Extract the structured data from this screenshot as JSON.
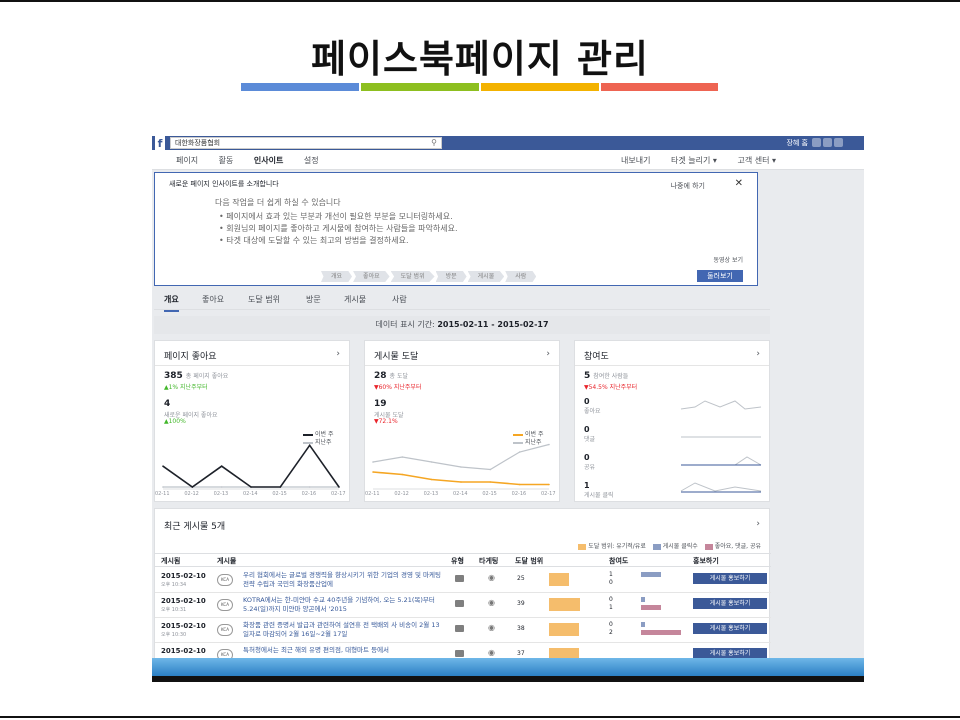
{
  "slide": {
    "title": "페이스북페이지 관리",
    "bar_colors": [
      "#5b8bd8",
      "#8dbf1f",
      "#f3b200",
      "#ee6452"
    ]
  },
  "fb": {
    "search_value": "대한화장품협회",
    "top_right": "장혜  홈",
    "nav_left": [
      "페이지",
      "활동",
      "인사이트",
      "설정"
    ],
    "nav_right": [
      "내보내기",
      "타겟 늘리기 ▾",
      "고객 센터 ▾"
    ],
    "intro": {
      "header": "새로운 페이지 인사이트를 소개합니다",
      "later": "나중에 하기",
      "close": "✕",
      "lead": "다음 작업을 더 쉽게 하실 수 있습니다",
      "bullets": [
        "• 페이지에서 효과 있는 부분과 개선이 필요한 부분을 모니터링하세요.",
        "• 회원님의 페이지를 좋아하고 게시물에 참여하는 사람들을 파악하세요.",
        "• 타겟 대상에 도달할 수 있는 최고의 방법을 결정하세요."
      ],
      "video": "동영상 보기",
      "steps": [
        "개요",
        "좋아요",
        "도달 범위",
        "방문",
        "게시물",
        "사람"
      ],
      "next": "둘러보기"
    },
    "tabs": [
      "개요",
      "좋아요",
      "도달 범위",
      "방문",
      "게시물",
      "사람"
    ],
    "date_label": "데이터 표시 기간:",
    "date_range": "2015-02-11 - 2015-02-17",
    "cards": {
      "likes": {
        "title": "페이지 좋아요",
        "total": "385",
        "total_label": "총 페이지 좋아요",
        "total_change": "▲1% 지난주부터",
        "new": "4",
        "new_label": "새로운 페이지 좋아요",
        "new_change": "▲100%",
        "legend_this": "이번 주",
        "legend_last": "지난주"
      },
      "reach": {
        "title": "게시물 도달",
        "total": "28",
        "total_label": "총 도달",
        "total_change": "▼60% 지난주부터",
        "post": "19",
        "post_label": "게시물 도달",
        "post_change": "▼72.1%",
        "legend_this": "이번 주",
        "legend_last": "지난주"
      },
      "engagement": {
        "title": "참여도",
        "people": "5",
        "people_label": "참여한 사람들",
        "people_change": "▼54.5% 지난주부터",
        "rows": [
          {
            "value": "0",
            "label": "좋아요"
          },
          {
            "value": "0",
            "label": "댓글"
          },
          {
            "value": "0",
            "label": "공유"
          },
          {
            "value": "1",
            "label": "게시물 클릭"
          }
        ]
      }
    },
    "xticks": [
      "02-11",
      "02-12",
      "02-13",
      "02-14",
      "02-15",
      "02-16",
      "02-17"
    ],
    "recent": {
      "title": "최근 게시물 5개",
      "legend": [
        "도달 범위: 유기적/유료",
        "게시물 클릭수",
        "좋아요, 댓글, 공유"
      ],
      "legend_colors": [
        "#f5bd6c",
        "#8b9dc3",
        "#c5869b"
      ],
      "headers": [
        "게시됨",
        "게시물",
        "유형",
        "타게팅",
        "도달 범위",
        "참여도",
        "홍보하기"
      ],
      "rows": [
        {
          "date": "2015-02-10",
          "time": "오후 10:34",
          "text": "우리 협회에서는 글로벌 경쟁력을 향상시키기 위한 기업의 경영 및 마케팅 전략 수립과 국민의 화장품산업에",
          "reach": "25",
          "e1": "1",
          "e2": "0",
          "promo": "게시물 홍보하기"
        },
        {
          "date": "2015-02-10",
          "time": "오후 10:31",
          "text": "KOTRA에서는 한-미얀마 수교 40주년을 기념하여, 오는 5.21(목)부터 5.24(일)까지 미얀마 양곤에서 '2015",
          "reach": "39",
          "e1": "0",
          "e2": "1",
          "promo": "게시물 홍보하기"
        },
        {
          "date": "2015-02-10",
          "time": "오후 10:30",
          "text": "화장품 관련 증명서 발급과 관련하여 설연휴 전 택배외 사 비송이 2월 13일자로 마감되어 2월 16일~2월 17일",
          "reach": "38",
          "e1": "0",
          "e2": "2",
          "promo": "게시물 홍보하기"
        },
        {
          "date": "2015-02-10",
          "time": "",
          "text": "특허청에서는 최근 해외 유명 편의점, 대형마트 등에서",
          "reach": "37",
          "e1": "",
          "e2": "",
          "promo": "게시물 홍보하기"
        }
      ]
    }
  },
  "chart_data": [
    {
      "type": "line",
      "x": [
        "02-11",
        "02-12",
        "02-13",
        "02-14",
        "02-15",
        "02-16",
        "02-17"
      ],
      "series": [
        {
          "name": "이번 주",
          "values": [
            1,
            0,
            1,
            0,
            0,
            2,
            0
          ]
        },
        {
          "name": "지난주",
          "values": [
            0,
            0,
            0,
            0,
            0,
            0,
            0
          ]
        }
      ],
      "ylim": [
        0,
        2.4
      ]
    },
    {
      "type": "line",
      "x": [
        "02-11",
        "02-12",
        "02-13",
        "02-14",
        "02-15",
        "02-16",
        "02-17"
      ],
      "series": [
        {
          "name": "이번 주",
          "values": [
            6,
            5,
            3,
            2,
            2,
            1,
            1
          ]
        },
        {
          "name": "지난주",
          "values": [
            10,
            12,
            10,
            8,
            7,
            14,
            17
          ]
        }
      ],
      "ylim": [
        0,
        20
      ]
    }
  ]
}
